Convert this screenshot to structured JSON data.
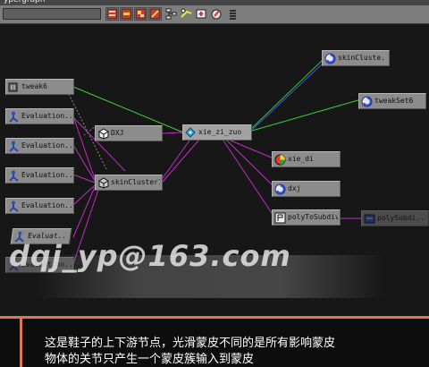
{
  "window": {
    "title": "ypergraph",
    "title_right": ""
  },
  "toolbar": {
    "filter_value": "",
    "icons": [
      "graph-upstream-icon",
      "graph-inout-icon",
      "graph-downstream-icon",
      "graph-clear-icon",
      "layout-tree-icon",
      "connect-icon",
      "add-node-icon",
      "edit-node-icon",
      "list-view-icon"
    ]
  },
  "nodes": {
    "tweak6": "tweak6",
    "evaluation_1": "Evaluation...",
    "evaluation_2": "Evaluation...",
    "evaluation_3": "Evaluation...",
    "evaluation_4": "Evaluation...",
    "evaluation_5": "Evaluat...",
    "evaluation_6": "Evaluation...",
    "dxj_upper": "DXJ",
    "skincluster1": "skinCluster1",
    "xie_zi_zuo": "xie_zi_zuo",
    "skincluste": "skinCluste...",
    "tweakset6": "tweakSet6",
    "xie_di": "xie_di",
    "dxj_lower": "dxj",
    "polytosubdiv6": "polyToSubdiv6",
    "subdiv": "polySubdi..."
  },
  "edge_colors": {
    "mesh_data": "#c42bc4",
    "set_membership": "#3ccd3c",
    "object_set": "#3f5bd8",
    "dependency": "#888888"
  },
  "watermark": "dqj_yp@163.com",
  "caption": {
    "line1": "这是鞋子的上下游节点，光滑蒙皮不同的是所有影响蒙皮",
    "line2": "物体的关节只产生一个蒙皮簇输入到蒙皮",
    "accent_color": "#d9794f"
  }
}
